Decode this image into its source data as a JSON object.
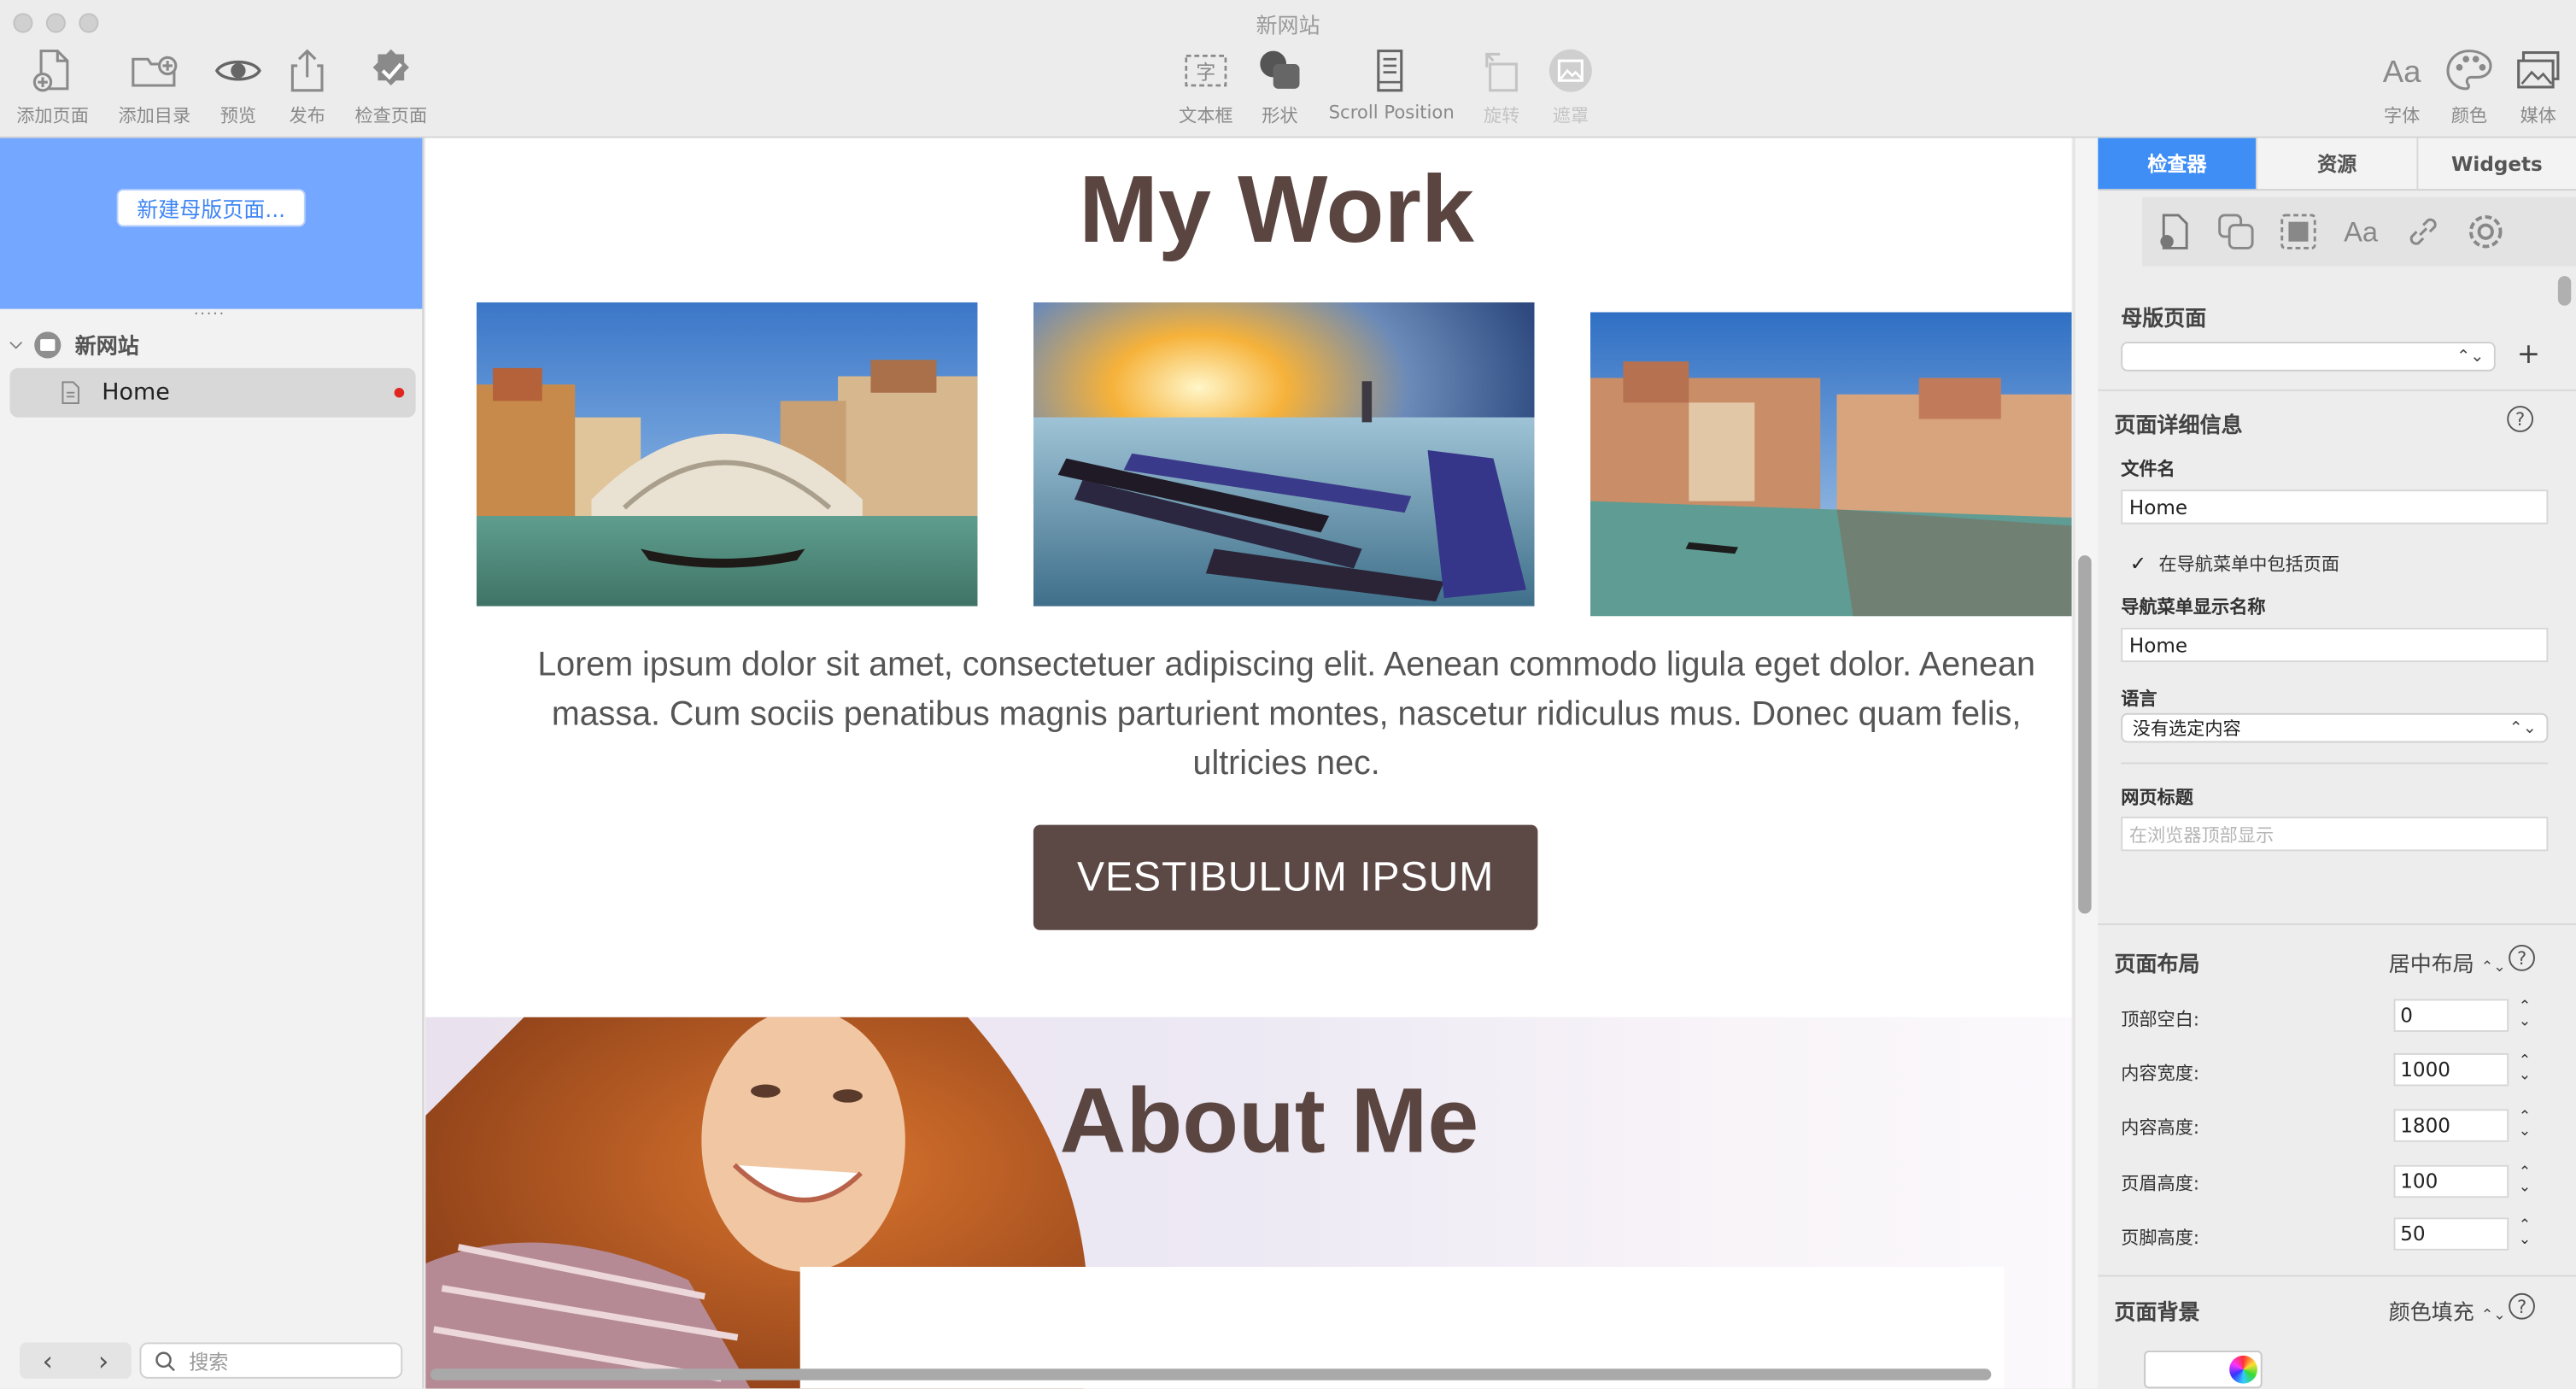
{
  "window": {
    "title": "新网站"
  },
  "toolbar": {
    "left": [
      {
        "label": "添加页面"
      },
      {
        "label": "添加目录"
      },
      {
        "label": "预览"
      },
      {
        "label": "发布"
      },
      {
        "label": "检查页面"
      }
    ],
    "center": [
      {
        "label": "文本框"
      },
      {
        "label": "形状"
      },
      {
        "label": "Scroll Position"
      },
      {
        "label": "旋转"
      },
      {
        "label": "遮罩"
      }
    ],
    "right": [
      {
        "label": "字体"
      },
      {
        "label": "颜色"
      },
      {
        "label": "媒体"
      }
    ]
  },
  "sidebar": {
    "new_master_label": "新建母版页面...",
    "site_name": "新网站",
    "pages": [
      {
        "name": "Home",
        "modified": true
      }
    ],
    "search_placeholder": "搜索"
  },
  "canvas": {
    "heading": "My Work",
    "photos": [
      {
        "alt": "venice-rialto"
      },
      {
        "alt": "venice-gondolas-sunset"
      },
      {
        "alt": "venice-grand-canal"
      }
    ],
    "body_text": "Lorem ipsum dolor sit amet, consectetuer adipiscing elit. Aenean commodo ligula eget dolor. Aenean massa. Cum sociis penatibus magnis parturient montes, nascetur ridiculus mus. Donec quam felis, ultricies nec.",
    "button_label": "VESTIBULUM IPSUM",
    "about_heading": "About Me"
  },
  "inspector": {
    "tabs": [
      {
        "label": "检查器",
        "active": true
      },
      {
        "label": "资源",
        "active": false
      },
      {
        "label": "Widgets",
        "active": false
      }
    ],
    "master_page_label": "母版页面",
    "master_page_value": "",
    "page_details_label": "页面详细信息",
    "filename_label": "文件名",
    "filename_value": "Home",
    "include_in_nav_label": "在导航菜单中包括页面",
    "include_in_nav_checked": true,
    "nav_name_label": "导航菜单显示名称",
    "nav_name_value": "Home",
    "language_label": "语言",
    "language_value": "没有选定内容",
    "page_title_label": "网页标题",
    "page_title_placeholder": "在浏览器顶部显示",
    "layout_label": "页面布局",
    "layout_value": "居中布局",
    "fields": [
      {
        "label": "顶部空白:",
        "value": "0"
      },
      {
        "label": "内容宽度:",
        "value": "1000"
      },
      {
        "label": "内容高度:",
        "value": "1800"
      },
      {
        "label": "页眉高度:",
        "value": "100"
      },
      {
        "label": "页脚高度:",
        "value": "50"
      }
    ],
    "background_label": "页面背景",
    "background_value": "颜色填充"
  },
  "colors": {
    "accent": "#3f8ef6",
    "heading": "#5a4541",
    "button": "#5c4844",
    "master_panel": "#74a7ff"
  }
}
